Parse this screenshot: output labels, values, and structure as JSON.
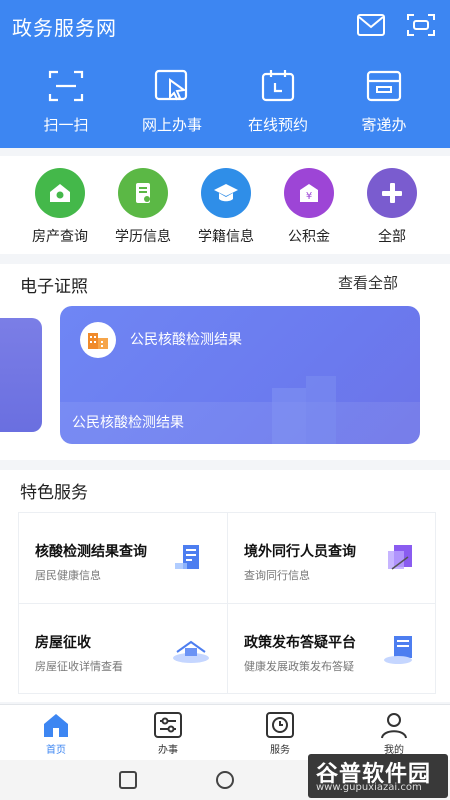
{
  "header": {
    "title": "政务服务网",
    "icons": [
      "mail-icon",
      "scan-frame-icon"
    ],
    "quick_actions": [
      {
        "label": "扫一扫",
        "icon": "scan-icon"
      },
      {
        "label": "网上办事",
        "icon": "pointer-icon"
      },
      {
        "label": "在线预约",
        "icon": "calendar-icon"
      },
      {
        "label": "寄递办",
        "icon": "mailbox-icon"
      }
    ]
  },
  "categories": [
    {
      "label": "房产查询",
      "icon": "house-icon",
      "color": "#44b84a"
    },
    {
      "label": "学历信息",
      "icon": "certificate-icon",
      "color": "#5bb845"
    },
    {
      "label": "学籍信息",
      "icon": "graduation-cap-icon",
      "color": "#2f8ee8"
    },
    {
      "label": "公积金",
      "icon": "fund-icon",
      "color": "#9d45d6"
    },
    {
      "label": "全部",
      "icon": "plus-icon",
      "color": "#7a5ccf"
    }
  ],
  "certificates": {
    "title": "电子证照",
    "view_all": "查看全部",
    "card": {
      "name": "公民核酸检测结果",
      "footer": "公民核酸检测结果"
    }
  },
  "featured": {
    "title": "特色服务",
    "items": [
      {
        "title": "核酸检测结果查询",
        "subtitle": "居民健康信息"
      },
      {
        "title": "境外同行人员查询",
        "subtitle": "查询同行信息"
      },
      {
        "title": "房屋征收",
        "subtitle": "房屋征收详情查看"
      },
      {
        "title": "政策发布答疑平台",
        "subtitle": "健康发展政策发布答疑"
      }
    ]
  },
  "bottom_nav": [
    {
      "label": "首页",
      "icon": "home-icon",
      "active": true
    },
    {
      "label": "办事",
      "icon": "sliders-icon",
      "active": false
    },
    {
      "label": "服务",
      "icon": "clock-icon",
      "active": false
    },
    {
      "label": "我的",
      "icon": "user-icon",
      "active": false
    }
  ],
  "watermark": {
    "brand": "谷普软件园",
    "url": "www.gupuxiazai.com"
  },
  "colors": {
    "primary": "#3d86f2",
    "card_gradient": "#6f86f4"
  }
}
